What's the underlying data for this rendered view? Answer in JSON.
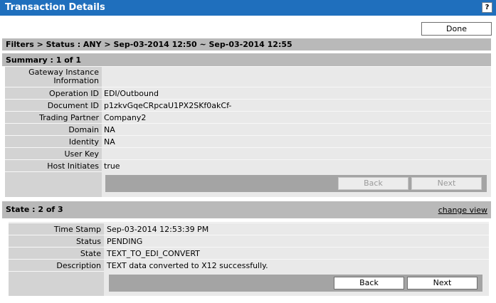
{
  "window": {
    "title": "Transaction Details",
    "help_label": "?"
  },
  "actions": {
    "done_label": "Done"
  },
  "filters": {
    "text": "Filters > Status : ANY > Sep-03-2014 12:50 ~ Sep-03-2014 12:55"
  },
  "summary": {
    "heading": "Summary : 1 of 1",
    "fields": [
      {
        "label": "Gateway Instance Information",
        "value": ""
      },
      {
        "label": "Operation ID",
        "value": "EDI/Outbound"
      },
      {
        "label": "Document ID",
        "value": "p1zkvGqeCRpcaU1PX2SKf0akCf-"
      },
      {
        "label": "Trading Partner",
        "value": "Company2"
      },
      {
        "label": "Domain",
        "value": "NA"
      },
      {
        "label": "Identity",
        "value": "NA"
      },
      {
        "label": "User Key",
        "value": ""
      },
      {
        "label": "Host Initiates",
        "value": "true"
      }
    ],
    "back_label": "Back",
    "next_label": "Next"
  },
  "state": {
    "heading": "State : 2 of 3",
    "change_view_label": "change view",
    "fields": [
      {
        "label": "Time Stamp",
        "value": "Sep-03-2014 12:53:39 PM"
      },
      {
        "label": "Status",
        "value": "PENDING"
      },
      {
        "label": "State",
        "value": "TEXT_TO_EDI_CONVERT"
      },
      {
        "label": "Description",
        "value": "TEXT data converted to X12 successfully."
      }
    ],
    "back_label": "Back",
    "next_label": "Next"
  },
  "colors": {
    "titlebar": "#1f6fbd",
    "header_gray": "#b9b9b9",
    "label_gray": "#d3d3d3",
    "panel_gray": "#e9e9e9",
    "navbar_gray": "#a4a4a4"
  }
}
